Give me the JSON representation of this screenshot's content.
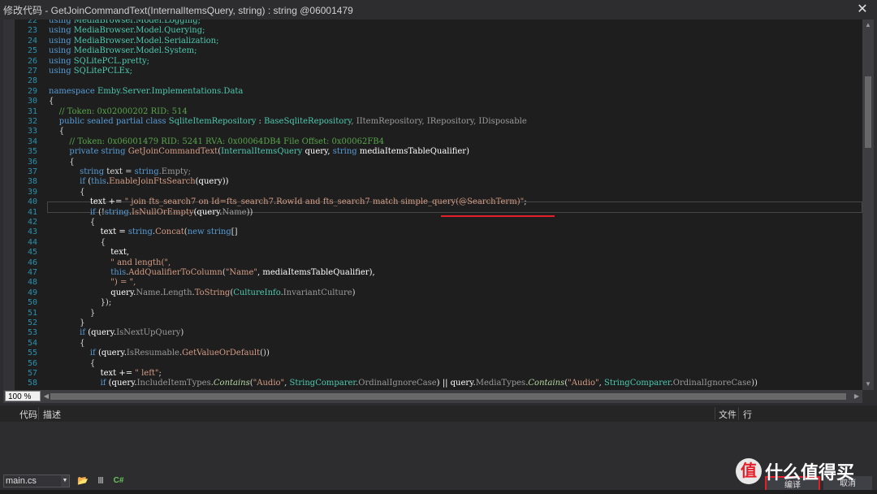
{
  "window": {
    "title": "修改代码 - GetJoinCommandText(InternalItemsQuery, string) : string @06001479",
    "close_label": "✕"
  },
  "code_lines": [
    {
      "n": "22",
      "tokens": [
        {
          "t": "using ",
          "c": "kw"
        },
        {
          "t": "MediaBrowser.Model.Logging;",
          "c": "ty"
        }
      ]
    },
    {
      "n": "23",
      "tokens": [
        {
          "t": "using ",
          "c": "kw"
        },
        {
          "t": "MediaBrowser.Model.Querying;",
          "c": "ty"
        }
      ]
    },
    {
      "n": "24",
      "tokens": [
        {
          "t": "using ",
          "c": "kw"
        },
        {
          "t": "MediaBrowser.Model.Serialization;",
          "c": "ty"
        }
      ]
    },
    {
      "n": "25",
      "tokens": [
        {
          "t": "using ",
          "c": "kw"
        },
        {
          "t": "MediaBrowser.Model.System;",
          "c": "ty"
        }
      ]
    },
    {
      "n": "26",
      "tokens": [
        {
          "t": "using ",
          "c": "kw"
        },
        {
          "t": "SQLitePCL.pretty;",
          "c": "ty"
        }
      ]
    },
    {
      "n": "27",
      "tokens": [
        {
          "t": "using ",
          "c": "kw"
        },
        {
          "t": "SQLitePCLEx;",
          "c": "ty"
        }
      ]
    },
    {
      "n": "28",
      "tokens": []
    },
    {
      "n": "29",
      "tokens": [
        {
          "t": "namespace ",
          "c": "kw"
        },
        {
          "t": "Emby.Server.Implementations.Data",
          "c": "ty"
        }
      ]
    },
    {
      "n": "30",
      "tokens": [
        {
          "t": "{",
          "c": "id"
        }
      ]
    },
    {
      "n": "31",
      "tokens": [
        {
          "t": "    // Token: 0x02000202 RID: 514",
          "c": "cm"
        }
      ]
    },
    {
      "n": "32",
      "tokens": [
        {
          "t": "    public sealed partial class ",
          "c": "kw"
        },
        {
          "t": "SqliteItemRepository",
          "c": "ty"
        },
        {
          "t": " : ",
          "c": "id"
        },
        {
          "t": "BaseSqliteRepository",
          "c": "ty"
        },
        {
          "t": ", IItemRepository, IRepository, IDisposable",
          "c": "mem"
        }
      ]
    },
    {
      "n": "33",
      "tokens": [
        {
          "t": "    {",
          "c": "id"
        }
      ]
    },
    {
      "n": "34",
      "tokens": [
        {
          "t": "        // Token: 0x06001479 RID: 5241 RVA: 0x00064DB4 File Offset: 0x00062FB4",
          "c": "cm"
        }
      ]
    },
    {
      "n": "35",
      "tokens": [
        {
          "t": "        private string ",
          "c": "kw"
        },
        {
          "t": "GetJoinCommandText",
          "c": "str"
        },
        {
          "t": "(",
          "c": "id"
        },
        {
          "t": "InternalItemsQuery",
          "c": "ty"
        },
        {
          "t": " query, ",
          "c": "bold"
        },
        {
          "t": "string ",
          "c": "kw"
        },
        {
          "t": "mediaItemsTableQualifier)",
          "c": "bold"
        }
      ]
    },
    {
      "n": "36",
      "tokens": [
        {
          "t": "        {",
          "c": "id"
        }
      ]
    },
    {
      "n": "37",
      "tokens": [
        {
          "t": "            string ",
          "c": "kw"
        },
        {
          "t": "text = ",
          "c": "id"
        },
        {
          "t": "string",
          "c": "kw"
        },
        {
          "t": ".Empty;",
          "c": "mem"
        }
      ]
    },
    {
      "n": "38",
      "tokens": [
        {
          "t": "            if ",
          "c": "kw"
        },
        {
          "t": "(",
          "c": "id"
        },
        {
          "t": "this",
          "c": "kw"
        },
        {
          "t": ".",
          "c": "id"
        },
        {
          "t": "EnableJoinFtsSearch",
          "c": "str"
        },
        {
          "t": "(query))",
          "c": "bold"
        }
      ]
    },
    {
      "n": "39",
      "tokens": [
        {
          "t": "            {",
          "c": "id"
        }
      ]
    },
    {
      "n": "40",
      "tokens": [
        {
          "t": "                text += ",
          "c": "bold"
        },
        {
          "t": "\" join fts_search7 on Id=fts_search7.RowId and fts_search7 match simple_query(@SearchTerm)\"",
          "c": "str"
        },
        {
          "t": ";",
          "c": "id"
        }
      ]
    },
    {
      "n": "41",
      "tokens": [
        {
          "t": "                if ",
          "c": "kw"
        },
        {
          "t": "(!",
          "c": "id"
        },
        {
          "t": "string",
          "c": "kw"
        },
        {
          "t": ".",
          "c": "id"
        },
        {
          "t": "IsNullOrEmpty",
          "c": "str"
        },
        {
          "t": "(query.",
          "c": "bold"
        },
        {
          "t": "Name",
          "c": "mem"
        },
        {
          "t": "))",
          "c": "id"
        }
      ]
    },
    {
      "n": "42",
      "tokens": [
        {
          "t": "                {",
          "c": "id"
        }
      ]
    },
    {
      "n": "43",
      "tokens": [
        {
          "t": "                    text = ",
          "c": "bold"
        },
        {
          "t": "string",
          "c": "kw"
        },
        {
          "t": ".",
          "c": "id"
        },
        {
          "t": "Concat",
          "c": "str"
        },
        {
          "t": "(",
          "c": "id"
        },
        {
          "t": "new string",
          "c": "kw"
        },
        {
          "t": "[]",
          "c": "id"
        }
      ]
    },
    {
      "n": "44",
      "tokens": [
        {
          "t": "                    {",
          "c": "id"
        }
      ]
    },
    {
      "n": "45",
      "tokens": [
        {
          "t": "                        text,",
          "c": "bold"
        }
      ]
    },
    {
      "n": "46",
      "tokens": [
        {
          "t": "                        \" and length(\",",
          "c": "str"
        }
      ]
    },
    {
      "n": "47",
      "tokens": [
        {
          "t": "                        this",
          "c": "kw"
        },
        {
          "t": ".",
          "c": "id"
        },
        {
          "t": "AddQualifierToColumn",
          "c": "str"
        },
        {
          "t": "(",
          "c": "id"
        },
        {
          "t": "\"Name\"",
          "c": "str"
        },
        {
          "t": ", mediaItemsTableQualifier),",
          "c": "bold"
        }
      ]
    },
    {
      "n": "48",
      "tokens": [
        {
          "t": "                        \") = \",",
          "c": "str"
        }
      ]
    },
    {
      "n": "49",
      "tokens": [
        {
          "t": "                        query.",
          "c": "bold"
        },
        {
          "t": "Name",
          "c": "mem"
        },
        {
          "t": ".",
          "c": "id"
        },
        {
          "t": "Length",
          "c": "mem"
        },
        {
          "t": ".",
          "c": "id"
        },
        {
          "t": "ToString",
          "c": "str"
        },
        {
          "t": "(",
          "c": "id"
        },
        {
          "t": "CultureInfo",
          "c": "ty"
        },
        {
          "t": ".",
          "c": "id"
        },
        {
          "t": "InvariantCulture",
          "c": "mem"
        },
        {
          "t": ")",
          "c": "id"
        }
      ]
    },
    {
      "n": "50",
      "tokens": [
        {
          "t": "                    });",
          "c": "id"
        }
      ]
    },
    {
      "n": "51",
      "tokens": [
        {
          "t": "                }",
          "c": "id"
        }
      ]
    },
    {
      "n": "52",
      "tokens": [
        {
          "t": "            }",
          "c": "id"
        }
      ]
    },
    {
      "n": "53",
      "tokens": [
        {
          "t": "            if ",
          "c": "kw"
        },
        {
          "t": "(query.",
          "c": "bold"
        },
        {
          "t": "IsNextUpQuery",
          "c": "mem"
        },
        {
          "t": ")",
          "c": "id"
        }
      ]
    },
    {
      "n": "54",
      "tokens": [
        {
          "t": "            {",
          "c": "id"
        }
      ]
    },
    {
      "n": "55",
      "tokens": [
        {
          "t": "                if ",
          "c": "kw"
        },
        {
          "t": "(query.",
          "c": "bold"
        },
        {
          "t": "IsResumable",
          "c": "mem"
        },
        {
          "t": ".",
          "c": "id"
        },
        {
          "t": "GetValueOrDefault",
          "c": "str"
        },
        {
          "t": "())",
          "c": "id"
        }
      ]
    },
    {
      "n": "56",
      "tokens": [
        {
          "t": "                {",
          "c": "id"
        }
      ]
    },
    {
      "n": "57",
      "tokens": [
        {
          "t": "                    text += ",
          "c": "bold"
        },
        {
          "t": "\" left\"",
          "c": "str"
        },
        {
          "t": ";",
          "c": "id"
        }
      ]
    },
    {
      "n": "58",
      "tokens": [
        {
          "t": "                    if ",
          "c": "kw"
        },
        {
          "t": "(query.",
          "c": "bold"
        },
        {
          "t": "IncludeItemTypes",
          "c": "mem"
        },
        {
          "t": ".",
          "c": "id"
        },
        {
          "t": "Contains",
          "c": "it"
        },
        {
          "t": "(",
          "c": "id"
        },
        {
          "t": "\"Audio\"",
          "c": "str"
        },
        {
          "t": ", ",
          "c": "id"
        },
        {
          "t": "StringComparer",
          "c": "ty"
        },
        {
          "t": ".",
          "c": "id"
        },
        {
          "t": "OrdinalIgnoreCase",
          "c": "mem"
        },
        {
          "t": ") || query.",
          "c": "bold"
        },
        {
          "t": "MediaTypes",
          "c": "mem"
        },
        {
          "t": ".",
          "c": "id"
        },
        {
          "t": "Contains",
          "c": "it"
        },
        {
          "t": "(",
          "c": "id"
        },
        {
          "t": "\"Audio\"",
          "c": "str"
        },
        {
          "t": ", ",
          "c": "id"
        },
        {
          "t": "StringComparer",
          "c": "ty"
        },
        {
          "t": ".",
          "c": "id"
        },
        {
          "t": "OrdinalIgnoreCase",
          "c": "mem"
        },
        {
          "t": "))",
          "c": "id"
        }
      ]
    }
  ],
  "zoom": {
    "value": "100 %"
  },
  "error_panel": {
    "col_code": "代码",
    "col_desc": "描述",
    "col_file": "文件",
    "col_line": "行"
  },
  "footer": {
    "file_name": "main.cs",
    "lang_label": "C#",
    "compile_label": "编译",
    "cancel_label": "取消"
  },
  "watermark": {
    "logo_text": "值",
    "brand_text": "什么值得买"
  },
  "colors": {
    "accent_red": "#e51e2a",
    "editor_bg": "#1e1e1e"
  }
}
